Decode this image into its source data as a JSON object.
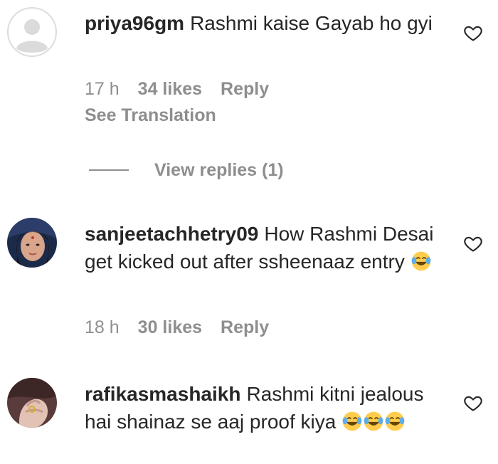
{
  "comments": [
    {
      "username": "priya96gm",
      "text": "Rashmi kaise Gayab ho gyi",
      "time": "17 h",
      "likes": "34 likes",
      "reply": "Reply",
      "translation": "See Translation",
      "view_replies": "View replies (1)",
      "emojis": []
    },
    {
      "username": "sanjeetachhetry09",
      "text": "How Rashmi Desai get kicked out after ssheenaaz entry",
      "time": "18 h",
      "likes": "30 likes",
      "reply": "Reply",
      "emojis": [
        "face-with-tears-of-joy"
      ]
    },
    {
      "username": "rafikasmashaikh",
      "text": "Rashmi kitni jealous hai shainaz se aaj proof kiya",
      "emojis": [
        "face-with-tears-of-joy",
        "face-with-tears-of-joy",
        "face-with-tears-of-joy"
      ]
    }
  ],
  "colors": {
    "text": "#262626",
    "secondary": "#8e8e8e",
    "emoji_face": "#FFCC4D",
    "emoji_tears": "#5DADEC"
  }
}
